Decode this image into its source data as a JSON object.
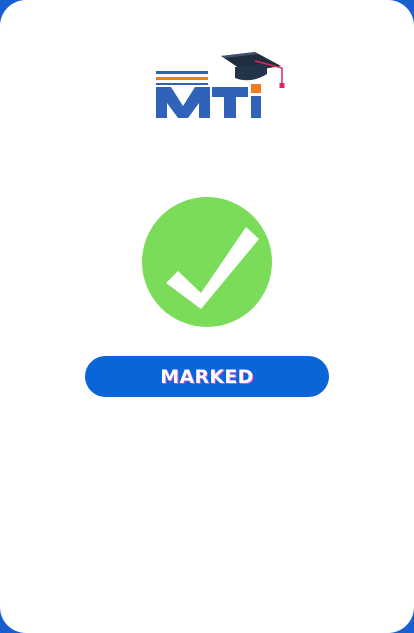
{
  "logo": {
    "text": "MTI",
    "icon": "graduation-cap-icon",
    "colors": {
      "blue": "#2f62b8",
      "orange": "#f07c22",
      "cap": "#1f2d3d",
      "tassel": "#e3245c"
    }
  },
  "status": {
    "icon": "check-icon",
    "circle_color": "#7bdc5a",
    "label": "MARKED"
  },
  "colors": {
    "frame": "#1a5fd0",
    "card": "#ffffff",
    "button": "#0a66d8"
  }
}
